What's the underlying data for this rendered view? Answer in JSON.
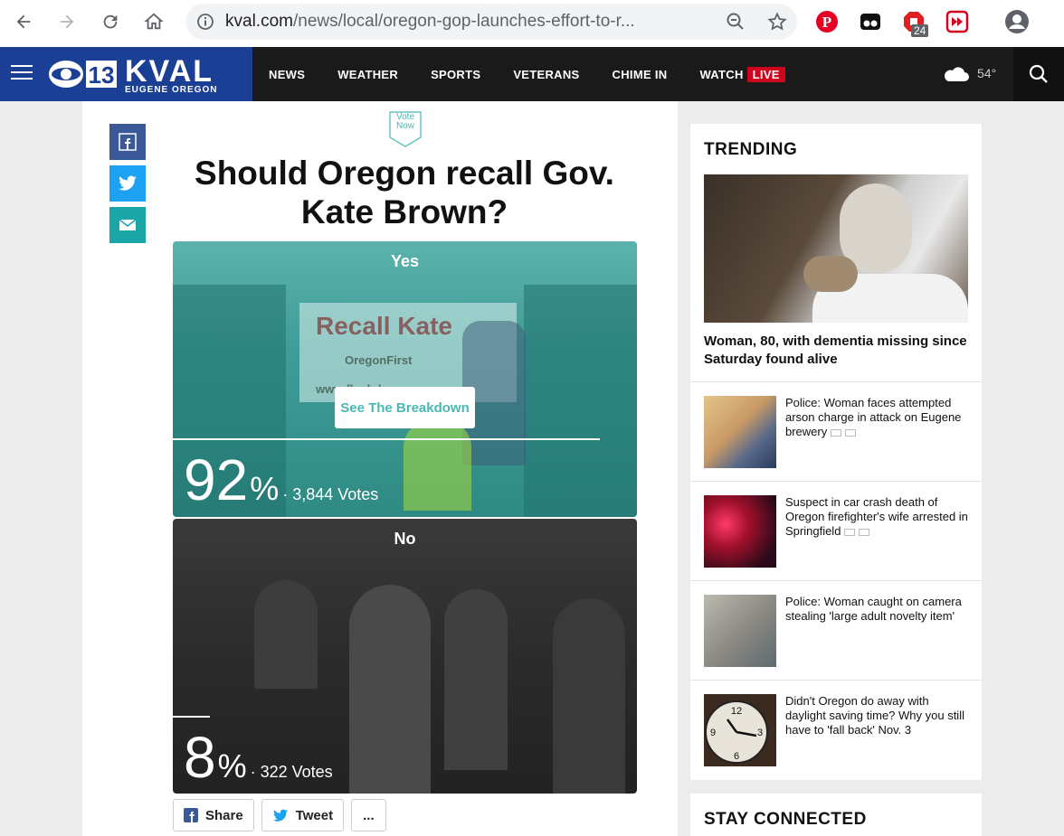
{
  "browser": {
    "url_host": "kval.com",
    "url_path": "/news/local/oregon-gop-launches-effort-to-r...",
    "extension_badge": "24"
  },
  "header": {
    "logo_text": "KVAL",
    "logo_sub": "EUGENE OREGON",
    "menu": [
      "NEWS",
      "WEATHER",
      "SPORTS",
      "VETERANS",
      "CHIME IN",
      "WATCH"
    ],
    "live_label": "LIVE",
    "temperature": "54°"
  },
  "poll": {
    "vote_tag": [
      "Vote",
      "Now"
    ],
    "title": "Should Oregon recall Gov. Kate Brown?",
    "options": [
      {
        "label": "Yes",
        "percent": "92",
        "percent_sign": "%",
        "votes": "· 3,844 Votes",
        "fraction": 0.92
      },
      {
        "label": "No",
        "percent": "8",
        "percent_sign": "%",
        "votes": "· 322 Votes",
        "fraction": 0.08
      }
    ],
    "breakdown_label": "See The Breakdown",
    "sign": {
      "line1": "Recall Kate",
      "line2": "OregonFirst",
      "line3": "www.flushdown"
    },
    "share_label": "Share",
    "tweet_label": "Tweet",
    "more_label": "..."
  },
  "sidebar": {
    "trending_title": "TRENDING",
    "hero_caption": "Woman, 80, with dementia missing since Saturday found alive",
    "items": [
      {
        "text": "Police: Woman faces attempted arson charge in attack on Eugene brewery",
        "media": true
      },
      {
        "text": "Suspect in car crash death of Oregon firefighter's wife arrested in Springfield",
        "media": true
      },
      {
        "text": "Police: Woman caught on camera stealing 'large adult novelty item'",
        "media": false
      },
      {
        "text": "Didn't Oregon do away with daylight saving time? Why you still have to 'fall back' Nov. 3",
        "media": false
      }
    ],
    "stay_connected": "STAY CONNECTED"
  },
  "colors": {
    "accent": "#4ab8b3",
    "brand": "#1b3f95",
    "live": "#d0021b"
  }
}
